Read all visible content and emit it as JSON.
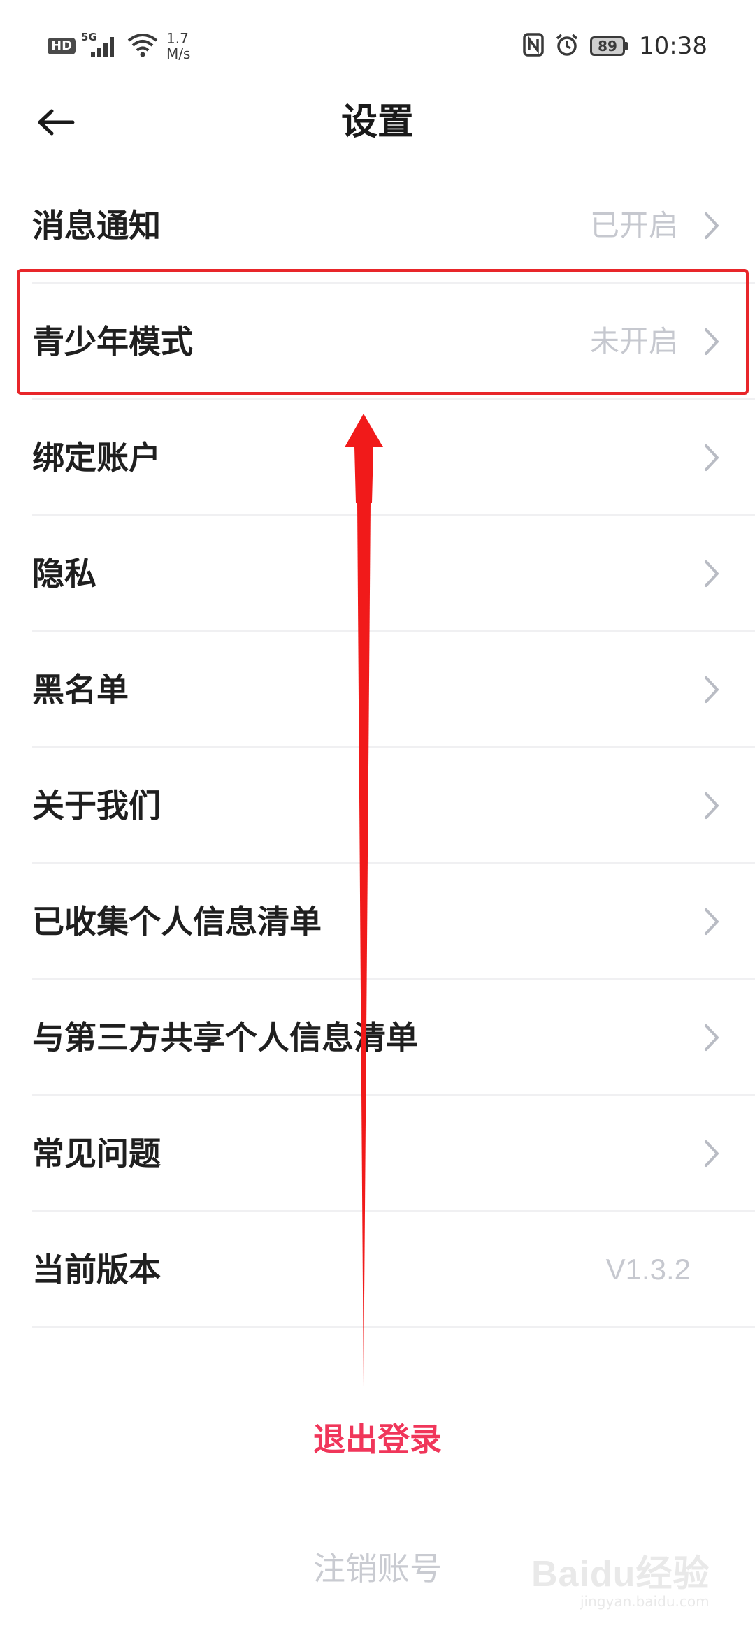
{
  "status_bar": {
    "hd_badge": "HD",
    "network_type": "5G",
    "speed_value": "1.7",
    "speed_unit": "M/s",
    "battery_level": "89",
    "time": "10:38",
    "icons": [
      "hd-icon",
      "signal-icon",
      "wifi-icon",
      "nfc-icon",
      "alarm-icon",
      "battery-icon"
    ]
  },
  "header": {
    "title": "设置",
    "back_icon": "back-arrow-icon"
  },
  "settings": {
    "items": [
      {
        "label": "消息通知",
        "value": "已开启",
        "chevron": true
      },
      {
        "label": "青少年模式",
        "value": "未开启",
        "chevron": true,
        "highlighted": true
      },
      {
        "label": "绑定账户",
        "value": "",
        "chevron": true
      },
      {
        "label": "隐私",
        "value": "",
        "chevron": true
      },
      {
        "label": "黑名单",
        "value": "",
        "chevron": true
      },
      {
        "label": "关于我们",
        "value": "",
        "chevron": true
      },
      {
        "label": "已收集个人信息清单",
        "value": "",
        "chevron": true
      },
      {
        "label": "与第三方共享个人信息清单",
        "value": "",
        "chevron": true
      },
      {
        "label": "常见问题",
        "value": "",
        "chevron": true
      },
      {
        "label": "当前版本",
        "value": "V1.3.2",
        "chevron": false
      }
    ]
  },
  "actions": {
    "logout_label": "退出登录",
    "cancel_account_label": "注销账号"
  },
  "annotation": {
    "color": "#e8262a"
  },
  "watermark": {
    "main": "Baidu经验",
    "sub": "jingyan.baidu.com"
  },
  "colors": {
    "logout": "#f0365a",
    "muted": "#c6c8cf",
    "text": "#1f1f1f"
  }
}
